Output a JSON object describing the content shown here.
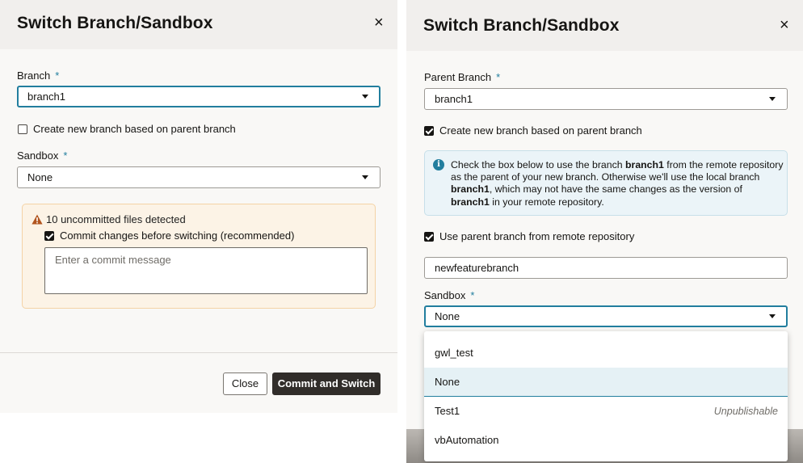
{
  "left_dialog": {
    "title": "Switch Branch/Sandbox",
    "close_glyph": "×",
    "branch_label": "Branch",
    "required_mark": "*",
    "branch_value": "branch1",
    "create_branch_checkbox": {
      "label": "Create new branch based on parent branch",
      "checked": false
    },
    "sandbox_label": "Sandbox",
    "sandbox_value": "None",
    "warning": {
      "icon": "warning-triangle-icon",
      "text": "10 uncommitted files detected",
      "commit_checkbox": {
        "label": "Commit changes before switching (recommended)",
        "checked": true
      },
      "commit_message_placeholder": "Enter a commit message"
    },
    "close_button": "Close",
    "commit_button": "Commit and Switch"
  },
  "right_dialog": {
    "title": "Switch Branch/Sandbox",
    "close_glyph": "×",
    "parent_branch_label": "Parent Branch",
    "required_mark": "*",
    "parent_branch_value": "branch1",
    "create_branch_checkbox": {
      "label": "Create new branch based on parent branch",
      "checked": true
    },
    "info": {
      "icon": "info-icon",
      "t1": "Check the box below to use the branch ",
      "b1": "branch1",
      "t2": " from the remote repository as the parent of your new branch. Otherwise we'll use the local branch ",
      "b2": "branch1",
      "t3": ", which may not have the same changes as the version of ",
      "b3": "branch1",
      "t4": " in your remote repository."
    },
    "remote_checkbox": {
      "label": "Use parent branch from remote repository",
      "checked": true
    },
    "new_branch_name": "newfeaturebranch",
    "sandbox_label": "Sandbox",
    "sandbox_value": "None",
    "sandbox_options": [
      {
        "label": "gwl_test",
        "note": ""
      },
      {
        "label": "None",
        "note": ""
      },
      {
        "label": "Test1",
        "note": "Unpublishable"
      },
      {
        "label": "vbAutomation",
        "note": ""
      }
    ]
  },
  "colors": {
    "accent": "#227e9e",
    "primary_button": "#312d2a",
    "warning_bg": "#fcf3e6",
    "info_bg": "#ebf4f8"
  }
}
